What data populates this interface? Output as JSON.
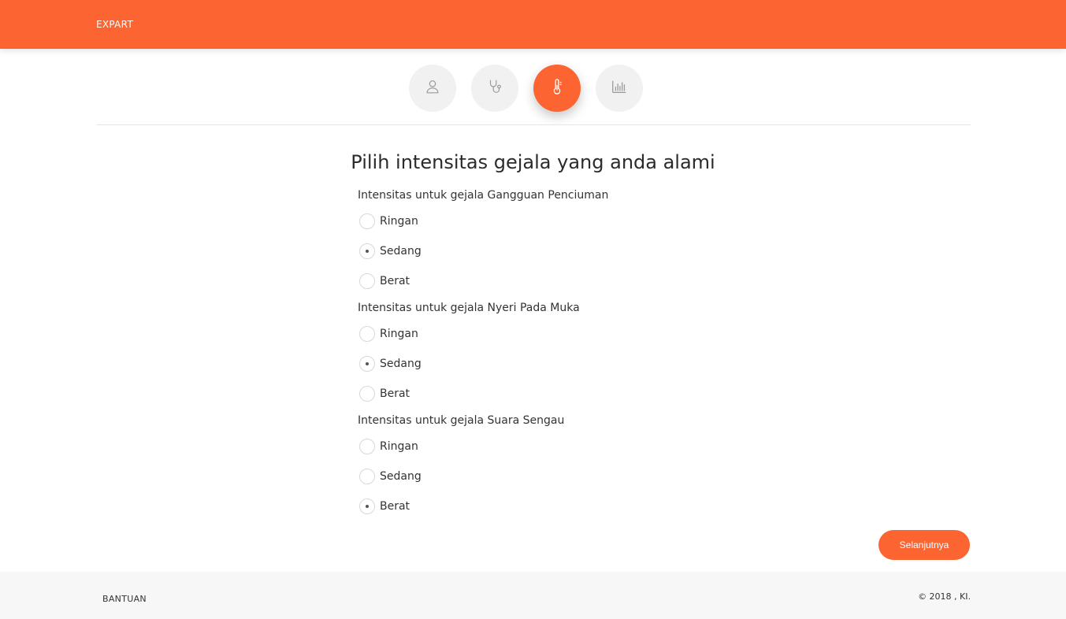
{
  "header": {
    "brand": "EXPART",
    "accent_color": "#fc6432"
  },
  "steps": [
    {
      "icon": "user-icon",
      "active": false
    },
    {
      "icon": "stethoscope-icon",
      "active": false
    },
    {
      "icon": "thermometer-icon",
      "active": true
    },
    {
      "icon": "bar-chart-icon",
      "active": false
    }
  ],
  "form": {
    "heading": "Pilih intensitas gejala yang anda alami",
    "groups": [
      {
        "label": "Intensitas untuk gejala Gangguan Penciuman",
        "options": [
          "Ringan",
          "Sedang",
          "Berat"
        ],
        "selected": "Sedang"
      },
      {
        "label": "Intensitas untuk gejala Nyeri Pada Muka",
        "options": [
          "Ringan",
          "Sedang",
          "Berat"
        ],
        "selected": "Sedang"
      },
      {
        "label": "Intensitas untuk gejala Suara Sengau",
        "options": [
          "Ringan",
          "Sedang",
          "Berat"
        ],
        "selected": "Berat"
      }
    ],
    "next_label": "Selanjutnya"
  },
  "footer": {
    "help": "BANTUAN",
    "copyright": "© 2018 , KI."
  }
}
